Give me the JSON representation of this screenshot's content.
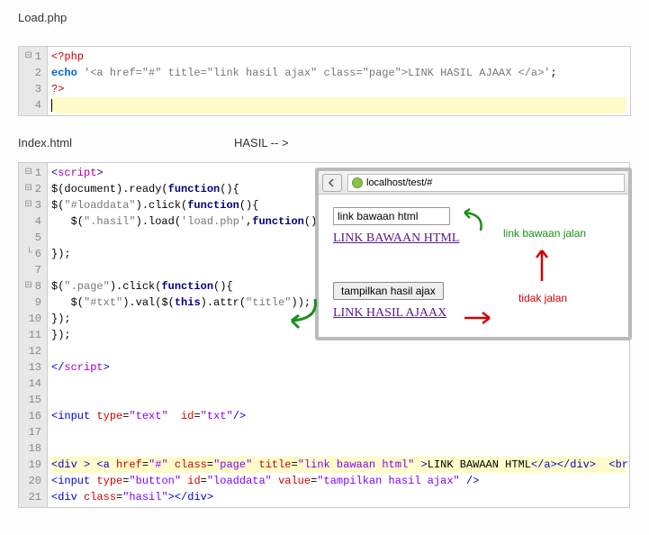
{
  "labels": {
    "load_php": "Load.php",
    "index_html": "Index.html",
    "hasil": "HASIL -- >"
  },
  "code1": {
    "nums": [
      "1",
      "2",
      "3",
      "4"
    ],
    "l1_open": "<?php",
    "l2_pre": "echo ",
    "l2_str": "'<a href=\"#\" title=\"link hasil ajax\" class=\"page\">LINK HASIL AJAAX </a>'",
    "l2_post": ";",
    "l3": "?>"
  },
  "code2": {
    "nums": [
      "1",
      "2",
      "3",
      "4",
      "5",
      "6",
      "7",
      "8",
      "9",
      "10",
      "11",
      "12",
      "13",
      "14",
      "15",
      "16",
      "17",
      "18",
      "19",
      "20",
      "21"
    ],
    "l1_a": "<",
    "l1_b": "script",
    "l1_c": ">",
    "l2_a": "$(document).ready(",
    "l2_b": "function",
    "l2_c": "(){",
    "l3_a": "$(",
    "l3_b": "\"#loaddata\"",
    "l3_c": ").click(",
    "l3_d": "function",
    "l3_e": "(){",
    "l4_a": "   $(",
    "l4_b": "\".hasil\"",
    "l4_c": ").load(",
    "l4_d": "'load.php'",
    "l4_e": ",",
    "l4_f": "function",
    "l4_g": "(){});",
    "l6": "});",
    "l8_a": "$(",
    "l8_b": "\".page\"",
    "l8_c": ").click(",
    "l8_d": "function",
    "l8_e": "(){",
    "l9_a": "   $(",
    "l9_b": "\"#txt\"",
    "l9_c": ").val($(",
    "l9_d": "this",
    "l9_e": ").attr(",
    "l9_f": "\"title\"",
    "l9_g": "));",
    "l10": "});",
    "l11": "});",
    "l13_a": "</",
    "l13_b": "script",
    "l13_c": ">",
    "l16_a": "<",
    "l16_b": "input",
    "l16_c": " type",
    "l16_d": "=",
    "l16_e": "\"text\"",
    "l16_f": "  id",
    "l16_g": "=",
    "l16_h": "\"txt\"",
    "l16_i": "/>",
    "l19_a": "<",
    "l19_b": "div",
    "l19_c": " > ",
    "l19_d": "<",
    "l19_e": "a",
    "l19_f": " href",
    "l19_g": "=",
    "l19_h": "\"#\"",
    "l19_i": " class",
    "l19_j": "=",
    "l19_k": "\"page\"",
    "l19_l": " title",
    "l19_m": "=",
    "l19_n": "\"link bawaan html\"",
    "l19_o": " >",
    "l19_p": "LINK BAWAAN HTML",
    "l19_q": "</",
    "l19_r": "a",
    "l19_s": "></",
    "l19_t": "div",
    "l19_u": ">  ",
    "l19_v": "<",
    "l19_w": "br",
    "l19_x": "><",
    "l19_y": "br",
    "l19_z": ">",
    "l20_a": "<",
    "l20_b": "input",
    "l20_c": " type",
    "l20_d": "=",
    "l20_e": "\"button\"",
    "l20_f": " id",
    "l20_g": "=",
    "l20_h": "\"loaddata\"",
    "l20_i": " value",
    "l20_j": "=",
    "l20_k": "\"tampilkan hasil ajax\"",
    "l20_l": " />",
    "l21_a": "<",
    "l21_b": "div",
    "l21_c": " class",
    "l21_d": "=",
    "l21_e": "\"hasil\"",
    "l21_f": "></",
    "l21_g": "div",
    "l21_h": ">"
  },
  "browser": {
    "url": "localhost/test/#",
    "input_value": "link bawaan html",
    "link1": "LINK BAWAAN HTML",
    "button": "tampilkan hasil ajax",
    "link2": "LINK HASIL AJAAX"
  },
  "annotations": {
    "green_right": "link bawaan jalan",
    "red_right": "tidak jalan"
  }
}
